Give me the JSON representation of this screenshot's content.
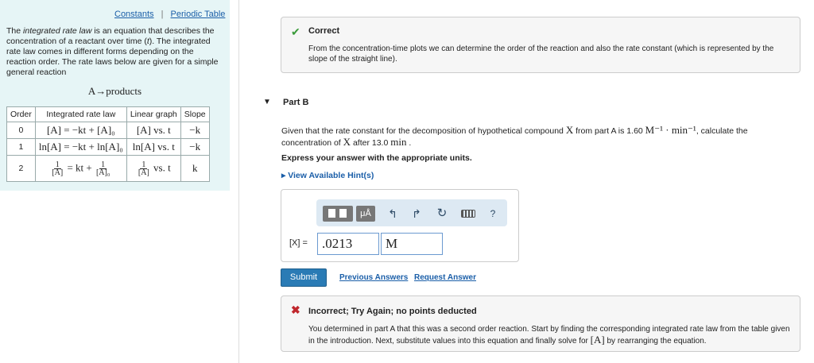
{
  "left_panel": {
    "links": {
      "constants": "Constants",
      "separator": "|",
      "periodic_table": "Periodic Table"
    },
    "intro": {
      "part1": "The ",
      "emphasis": "integrated rate law",
      "part2": " is an equation that describes the concentration of a reactant over time (",
      "variable": "t",
      "part3": "). The integrated rate law comes in different forms depending on the reaction order. The rate laws below are given for a simple general reaction"
    },
    "reaction": "A→products",
    "table": {
      "headers": [
        "Order",
        "Integrated rate law",
        "Linear graph",
        "Slope"
      ],
      "rows": [
        {
          "order": "0",
          "law": "[A] = −kt + [A]₀",
          "graph": "[A] vs. t",
          "slope": "−k"
        },
        {
          "order": "1",
          "law": "ln[A] = −kt + ln[A]₀",
          "graph": "ln[A] vs. t",
          "slope": "−k"
        },
        {
          "order": "2",
          "law_num_left": "1",
          "law_den_left": "[A]",
          "law_mid": "= kt +",
          "law_num_right": "1",
          "law_den_right": "[A]₀",
          "graph_num": "1",
          "graph_den": "[A]",
          "graph_tail": "vs. t",
          "slope": "k"
        }
      ]
    }
  },
  "feedback_correct": {
    "title": "Correct",
    "message": "From the concentration-time plots we can determine the order of the reaction and also the rate constant (which is represented by the slope of the straight line)."
  },
  "part_b": {
    "title": "Part B",
    "question_part1": "Given that the rate constant for the decomposition of hypothetical compound ",
    "compound": "X",
    "question_part2": " from part A is 1.60 ",
    "units": "M⁻¹ · min⁻¹",
    "question_part3": ", calculate the concentration of ",
    "question_part4": " after 13.0 ",
    "time_unit": "min",
    "question_end": " .",
    "instruction": "Express your answer with the appropriate units.",
    "hints_link": "▸ View Available Hint(s)"
  },
  "toolbar": {
    "units_button": "μÅ",
    "undo_icon": "↰",
    "redo_icon": "↱",
    "reset_icon": "↻",
    "help_label": "?"
  },
  "answer": {
    "label": "[X] =",
    "value": ".0213",
    "unit": "M"
  },
  "actions": {
    "submit": "Submit",
    "previous_answers": "Previous Answers",
    "request_answer": "Request Answer"
  },
  "feedback_incorrect": {
    "title": "Incorrect; Try Again; no points deducted",
    "message_part1": "You determined in part A that this was a second order reaction. Start by finding the corresponding integrated rate law from the table given in the introduction. Next, substitute values into this equation and finally solve for ",
    "message_var": "[A]",
    "message_part2": " by rearranging the equation."
  }
}
